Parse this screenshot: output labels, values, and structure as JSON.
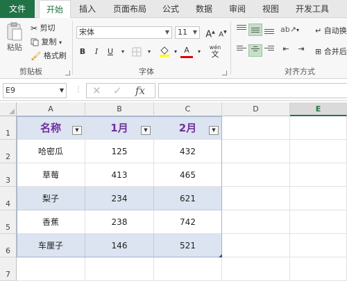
{
  "tabs": [
    {
      "label": "文件"
    },
    {
      "label": "开始"
    },
    {
      "label": "插入"
    },
    {
      "label": "页面布局"
    },
    {
      "label": "公式"
    },
    {
      "label": "数据"
    },
    {
      "label": "审阅"
    },
    {
      "label": "视图"
    },
    {
      "label": "开发工具"
    }
  ],
  "ribbon": {
    "clipboard": {
      "paste": "粘贴",
      "cut": "剪切",
      "copy": "复制",
      "format_painter": "格式刷",
      "group_label": "剪贴板"
    },
    "font": {
      "font_name": "宋体",
      "font_size": "11",
      "grow": "A",
      "shrink": "A",
      "bold": "B",
      "italic": "I",
      "underline": "U",
      "font_color_letter": "A",
      "phonetic": "wén",
      "group_label": "字体"
    },
    "alignment": {
      "wrap_text": "自动换",
      "merge_center": "合并后",
      "group_label": "对齐方式"
    }
  },
  "formula_bar": {
    "name_box": "E9",
    "formula": ""
  },
  "columns": [
    "A",
    "B",
    "C",
    "D",
    "E"
  ],
  "rows": [
    "1",
    "2",
    "3",
    "4",
    "5",
    "6",
    "7"
  ],
  "table": {
    "headers": [
      "名称",
      "1月",
      "2月"
    ],
    "rows": [
      [
        "哈密瓜",
        "125",
        "432"
      ],
      [
        "草莓",
        "413",
        "465"
      ],
      [
        "梨子",
        "234",
        "621"
      ],
      [
        "香蕉",
        "238",
        "742"
      ],
      [
        "车厘子",
        "146",
        "521"
      ]
    ]
  },
  "colors": {
    "accent": "#217346",
    "band": "#dbe4f0",
    "header_text": "#7030a0"
  }
}
